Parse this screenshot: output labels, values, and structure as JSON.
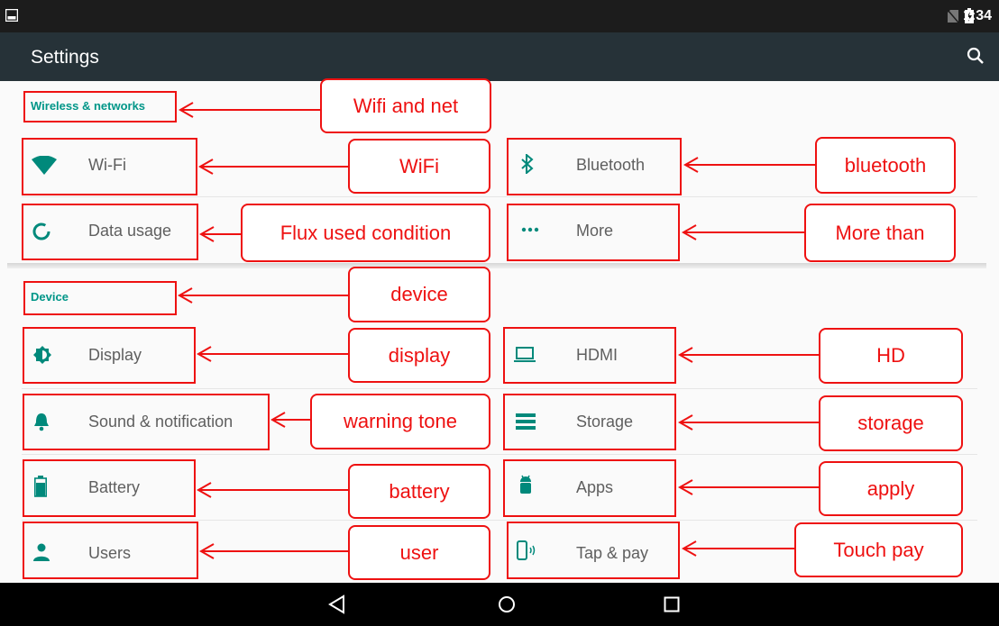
{
  "status_bar": {
    "time": "1:34",
    "icons": [
      "image-icon",
      "no-sim-icon",
      "battery-charging-icon"
    ]
  },
  "app_bar": {
    "title": "Settings",
    "search_icon": "search-icon"
  },
  "sections": {
    "wireless": {
      "title": "Wireless & networks",
      "items": [
        {
          "label": "Wi-Fi",
          "icon": "wifi-icon"
        },
        {
          "label": "Bluetooth",
          "icon": "bluetooth-icon"
        },
        {
          "label": "Data usage",
          "icon": "data-usage-icon"
        },
        {
          "label": "More",
          "icon": "more-icon"
        }
      ]
    },
    "device": {
      "title": "Device",
      "items": [
        {
          "label": "Display",
          "icon": "brightness-icon"
        },
        {
          "label": "HDMI",
          "icon": "laptop-icon"
        },
        {
          "label": "Sound & notification",
          "icon": "bell-icon"
        },
        {
          "label": "Storage",
          "icon": "storage-icon"
        },
        {
          "label": "Battery",
          "icon": "battery-icon"
        },
        {
          "label": "Apps",
          "icon": "android-icon"
        },
        {
          "label": "Users",
          "icon": "person-icon"
        },
        {
          "label": "Tap & pay",
          "icon": "tap-pay-icon"
        }
      ]
    }
  },
  "annotations": {
    "wifi_and_net": "Wifi and net",
    "wifi": "WiFi",
    "bluetooth": "bluetooth",
    "flux": "Flux used condition",
    "more_than": "More than",
    "device": "device",
    "display": "display",
    "hd": "HD",
    "warning_tone": "warning tone",
    "storage": "storage",
    "battery": "battery",
    "apply": "apply",
    "user": "user",
    "touch_pay": "Touch pay"
  },
  "nav_bar": {
    "buttons": [
      "back-icon",
      "home-icon",
      "recents-icon"
    ]
  },
  "colors": {
    "accent": "#009688",
    "annotation": "#ee1111",
    "appbar": "#263238",
    "icon": "#00897b"
  }
}
